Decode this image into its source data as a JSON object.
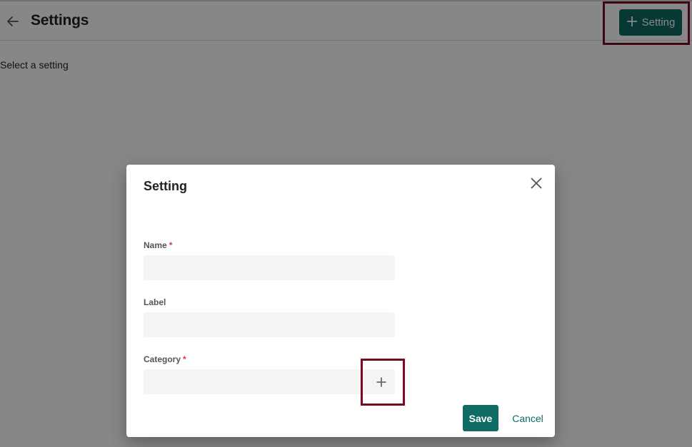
{
  "header": {
    "title": "Settings",
    "back_icon": "arrow-left-icon",
    "add_button_label": "Setting",
    "add_button_icon": "plus-icon"
  },
  "main": {
    "hint": "Select a setting"
  },
  "modal": {
    "title": "Setting",
    "close_icon": "close-icon",
    "fields": {
      "name": {
        "label": "Name",
        "required": "*",
        "value": ""
      },
      "label": {
        "label": "Label",
        "value": ""
      },
      "category": {
        "label": "Category",
        "required": "*",
        "value": "",
        "add_icon": "plus-icon"
      }
    },
    "save_label": "Save",
    "cancel_label": "Cancel"
  },
  "colors": {
    "accent": "#0f6b63",
    "required": "#d9363e",
    "highlight": "#7a0b1e"
  }
}
